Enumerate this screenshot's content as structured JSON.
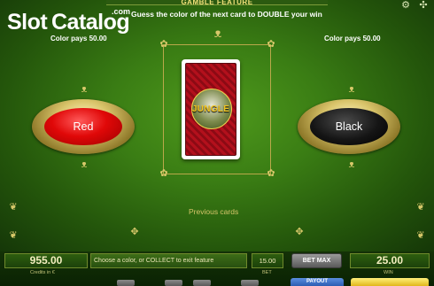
{
  "header": {
    "feature_title": "GAMBLE FEATURE",
    "instruction": "Guess the color of the next card to DOUBLE your win"
  },
  "watermark": {
    "slot": "Slot",
    "catalog": "Catalog",
    "com": ".com"
  },
  "gamble": {
    "red_pays": "Color pays 50.00",
    "black_pays": "Color pays 50.00",
    "red_label": "Red",
    "black_label": "Black",
    "card_back_text": "JUNGLE",
    "previous_cards_label": "Previous cards"
  },
  "bottom_bar": {
    "credits_value": "955.00",
    "credits_label": "Credits in €",
    "message": "Choose a color, or COLLECT to exit feature",
    "bet_value": "15.00",
    "bet_label": "BET",
    "bet_max_label": "BET MAX",
    "win_value": "25.00",
    "win_label": "WIN",
    "payout_label": "PAYOUT"
  },
  "icons": {
    "settings": "gear-icon",
    "help": "help-icon",
    "flourish": "butterfly-icon"
  },
  "colors": {
    "table_green": "#3a7d14",
    "gold_frame": "#b9a84a",
    "red_button": "#e00808",
    "black_button": "#151515",
    "instruction_text": "#ffffff",
    "label_gold": "#d6c46a"
  }
}
